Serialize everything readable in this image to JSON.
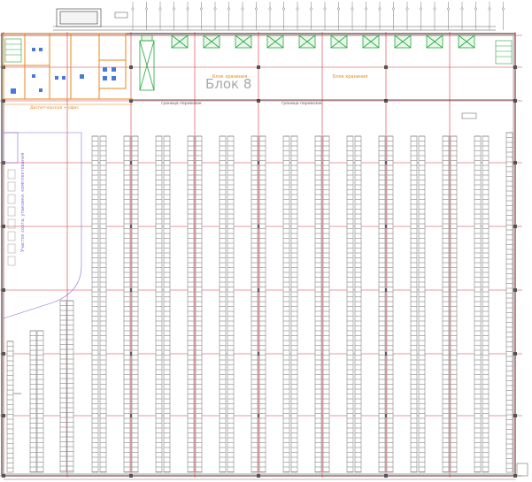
{
  "drawing": {
    "block_title": "Блок 8",
    "zone_label_left": "Блок хранения",
    "zone_label_right": "Блок хранения",
    "boundary_label_left": "граница перевозок",
    "boundary_label_right": "граница перевозок",
    "office_label": "Диспетчерская + офис",
    "side_zone_label": "Участок сорта, упаковки, комплектования",
    "rack_label_small": "Стеллаж"
  },
  "colors": {
    "axis_red": "#d8323c",
    "wall_orange": "#e8861a",
    "dock_green": "#22a83a",
    "rack_gray": "#6e6e6e",
    "text_gray": "#9a9a9a",
    "violet": "#8a6ad8"
  }
}
